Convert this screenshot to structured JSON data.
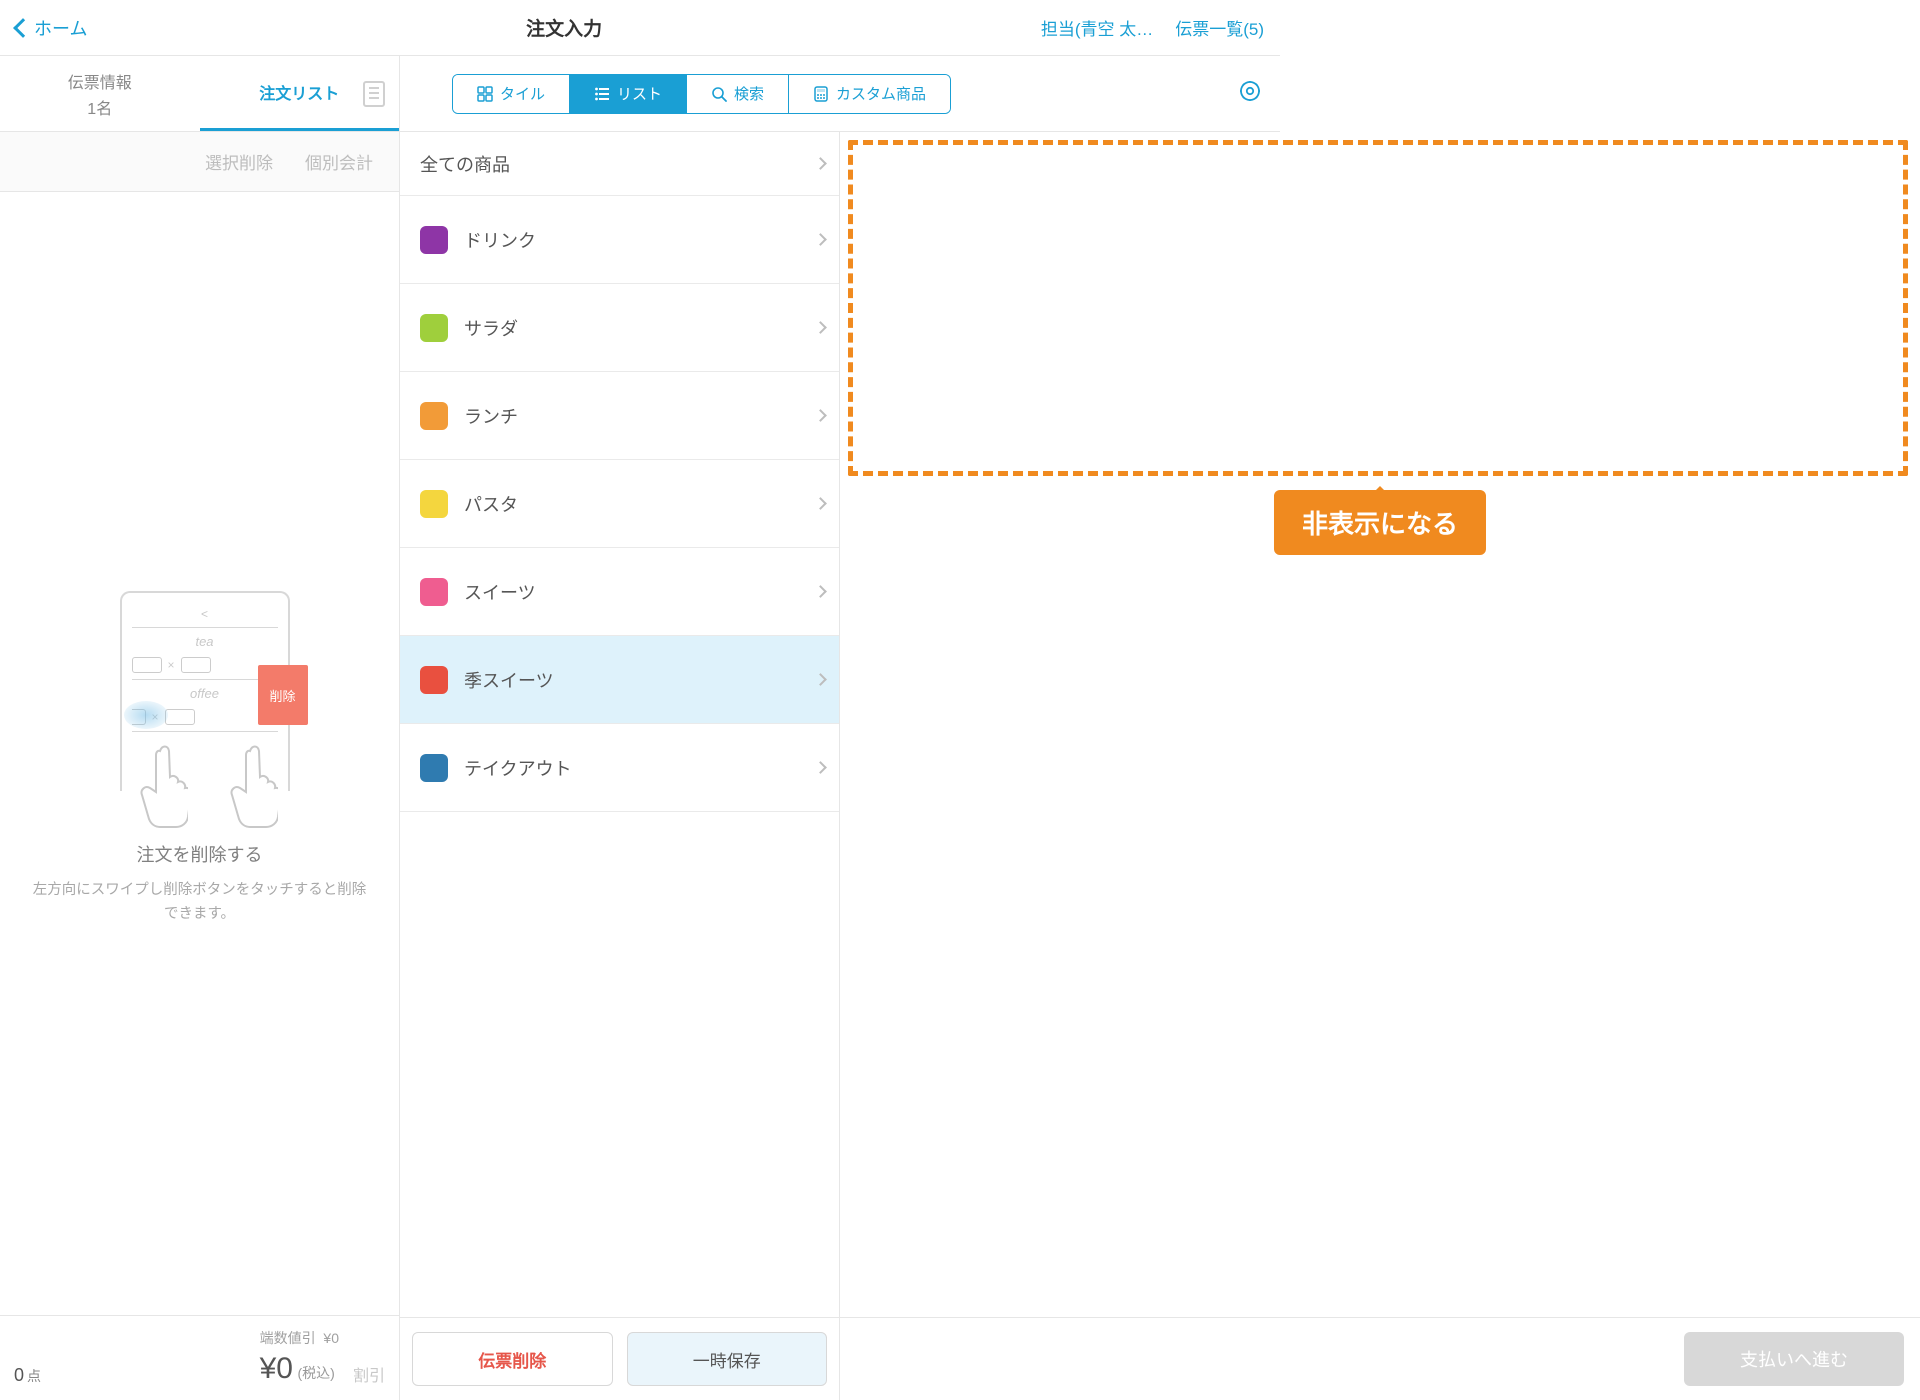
{
  "topbar": {
    "home": "ホーム",
    "title": "注文入力",
    "staff": "担当(青空 太…",
    "slips": "伝票一覧(5)"
  },
  "subheader": {
    "tab_slip_info": "伝票情報",
    "tab_slip_people": "1名",
    "tab_order_list": "注文リスト",
    "view_tile": "タイル",
    "view_list": "リスト",
    "view_search": "検索",
    "view_custom": "カスタム商品"
  },
  "left": {
    "action_delete_sel": "選択削除",
    "action_split": "個別会計",
    "illus_item1": "tea",
    "illus_item2": "offee",
    "illus_delete": "削除",
    "empty_title": "注文を削除する",
    "empty_desc": "左方向にスワイプし削除ボタンをタッチすると削除できます。",
    "footer_count_value": "0",
    "footer_count_unit": "点",
    "footer_rounding_label": "端数値引",
    "footer_rounding_value": "¥0",
    "footer_total": "¥0",
    "footer_tax": "(税込)",
    "footer_discount": "割引"
  },
  "categories": {
    "all": "全ての商品",
    "items": [
      {
        "label": "ドリンク",
        "color": "#8e35a6"
      },
      {
        "label": "サラダ",
        "color": "#9fcf3c"
      },
      {
        "label": "ランチ",
        "color": "#f29b38"
      },
      {
        "label": "パスタ",
        "color": "#f4d63e"
      },
      {
        "label": "スイーツ",
        "color": "#ef5d90"
      },
      {
        "label": "季スイーツ",
        "color": "#e9503f",
        "selected": true
      },
      {
        "label": "テイクアウト",
        "color": "#2f7bb0"
      }
    ]
  },
  "mid_footer": {
    "delete": "伝票削除",
    "save": "一時保存"
  },
  "right": {
    "callout": "非表示になる",
    "pay": "支払いへ進む"
  }
}
